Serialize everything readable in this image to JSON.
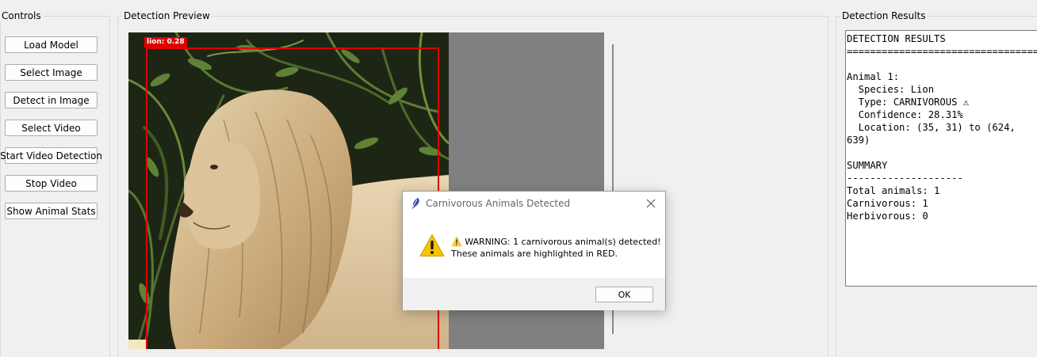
{
  "controls": {
    "title": "Controls",
    "buttons": [
      "Load Model",
      "Select Image",
      "Detect in Image",
      "Select Video",
      "Start Video Detection",
      "Stop Video",
      "Show Animal Stats"
    ]
  },
  "preview": {
    "title": "Detection Preview",
    "detection_label": "lion: 0.28",
    "box_color": "#e00000"
  },
  "results": {
    "title": "Detection Results",
    "text": "DETECTION RESULTS\n========================================\n\nAnimal 1:\n  Species: Lion\n  Type: CARNIVOROUS ⚠\n  Confidence: 28.31%\n  Location: (35, 31) to (624,\n639)\n\nSUMMARY\n--------------------\nTotal animals: 1\nCarnivorous: 1\nHerbivorous: 0"
  },
  "dialog": {
    "title": "Carnivorous Animals Detected",
    "line1": "⚠️ WARNING: 1 carnivorous animal(s) detected!",
    "line2": "These animals are highlighted in RED.",
    "ok_label": "OK",
    "icon": "warning-icon",
    "accent": "#f5c400"
  }
}
